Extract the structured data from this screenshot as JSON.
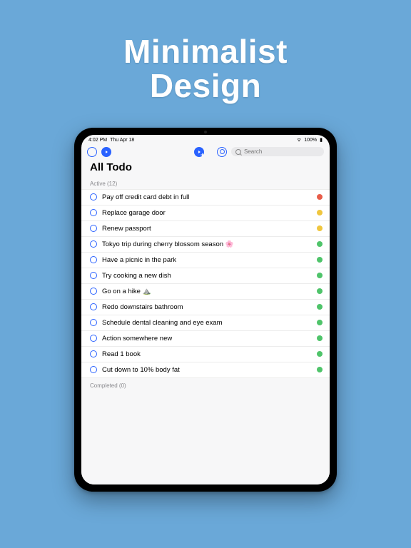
{
  "hero": {
    "line1": "Minimalist",
    "line2": "Design"
  },
  "statusbar": {
    "time": "4:02 PM",
    "date": "Thu Apr 18",
    "battery": "100%"
  },
  "search": {
    "placeholder": "Search"
  },
  "page": {
    "title": "All Todo"
  },
  "sections": {
    "active": {
      "label": "Active (12)"
    },
    "completed": {
      "label": "Completed (0)"
    }
  },
  "colors": {
    "red": "#e85d4a",
    "yellow": "#f0c63e",
    "green": "#4fc46a"
  },
  "todos": [
    {
      "text": "Pay off credit card debt in full",
      "color": "red"
    },
    {
      "text": "Replace garage door",
      "color": "yellow"
    },
    {
      "text": "Renew passport",
      "color": "yellow"
    },
    {
      "text": "Tokyo trip during cherry blossom season 🌸",
      "color": "green"
    },
    {
      "text": "Have a picnic in the park",
      "color": "green"
    },
    {
      "text": "Try cooking a new dish",
      "color": "green"
    },
    {
      "text": "Go on a hike ⛰️",
      "color": "green"
    },
    {
      "text": "Redo downstairs bathroom",
      "color": "green"
    },
    {
      "text": "Schedule dental cleaning and eye exam",
      "color": "green"
    },
    {
      "text": "Action somewhere new",
      "color": "green"
    },
    {
      "text": "Read 1 book",
      "color": "green"
    },
    {
      "text": "Cut down to 10% body fat",
      "color": "green"
    }
  ]
}
